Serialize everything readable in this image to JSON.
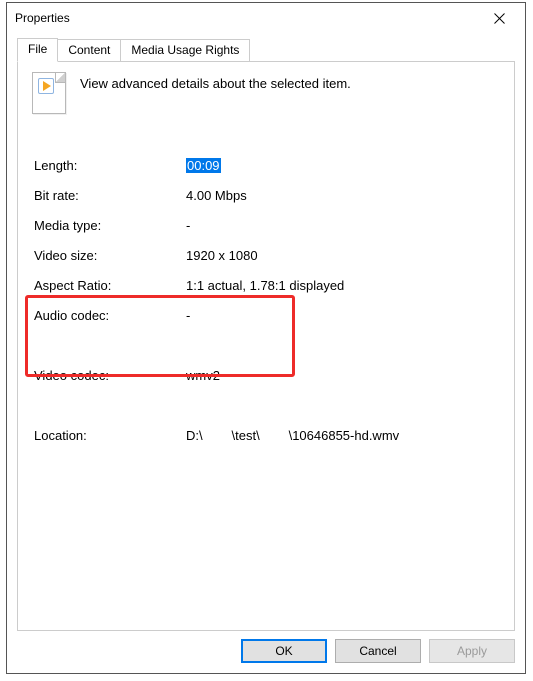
{
  "window": {
    "title": "Properties"
  },
  "tabs": {
    "file": "File",
    "content": "Content",
    "rights": "Media Usage Rights"
  },
  "intro": "View advanced details about the selected item.",
  "props": {
    "length_label": "Length:",
    "length_value": "00:09",
    "bitrate_label": "Bit rate:",
    "bitrate_value": "4.00 Mbps",
    "mediatype_label": "Media type:",
    "mediatype_value": "-",
    "videosize_label": "Video size:",
    "videosize_value": "1920 x 1080",
    "aspect_label": "Aspect Ratio:",
    "aspect_value": "1:1 actual, 1.78:1 displayed",
    "audcodec_label": "Audio codec:",
    "audcodec_value": "-",
    "vidcodec_label": "Video codec:",
    "vidcodec_value": "wmv2",
    "location_label": "Location:",
    "location_value": "D:\\        \\test\\        \\10646855-hd.wmv"
  },
  "buttons": {
    "ok": "OK",
    "cancel": "Cancel",
    "apply": "Apply"
  }
}
